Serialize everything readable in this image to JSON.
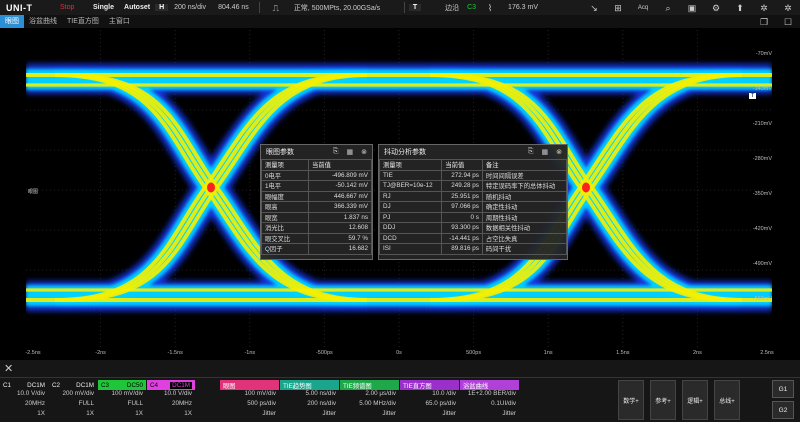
{
  "topbar": {
    "logo": "UNI-T",
    "run_state": "Stop",
    "single": "Single",
    "autoset": "Autoset",
    "h_key": "H",
    "timebase": "200 ns/div",
    "offset": "804.46 ns",
    "acq": "正常, 500MPts, 20.00GSa/s",
    "t_key": "T",
    "trig_type": "边沿",
    "trig_src": "C3",
    "trig_level": "176.3 mV",
    "acq_icon_label": "Acq"
  },
  "tabs": [
    "眼图",
    "浴盆曲线",
    "TIE直方图",
    "主窗口"
  ],
  "yticks": [
    "-70mV",
    "-140mV",
    "-210mV",
    "-280mV",
    "-350mV",
    "-420mV",
    "-490mV",
    "-560mV"
  ],
  "xticks": [
    "-2.5ns",
    "-2ns",
    "-1.5ns",
    "-1ns",
    "-500ps",
    "0s",
    "500ps",
    "1ns",
    "1.5ns",
    "2ns",
    "2.5ns"
  ],
  "side_label": "眼图",
  "eye_panel": {
    "title": "眼图参数",
    "headers": [
      "测量项",
      "当前值"
    ],
    "rows": [
      [
        "0电平",
        "-496.809 mV"
      ],
      [
        "1电平",
        "-50.142 mV"
      ],
      [
        "眼幅度",
        "446.667 mV"
      ],
      [
        "眼高",
        "366.339 mV"
      ],
      [
        "眼宽",
        "1.837 ns"
      ],
      [
        "消光比",
        "12.608"
      ],
      [
        "眼交叉比",
        "59.7 %"
      ],
      [
        "Q因子",
        "16.682"
      ]
    ]
  },
  "jitter_panel": {
    "title": "抖动分析参数",
    "headers": [
      "测量项",
      "当前值",
      "备注"
    ],
    "rows": [
      [
        "TIE",
        "272.94 ps",
        "时间间隔误差"
      ],
      [
        "TJ@BER=10e-12",
        "249.28 ps",
        "特定误码率下的总体抖动"
      ],
      [
        "RJ",
        "25.951 ps",
        "随机抖动"
      ],
      [
        "DJ",
        "97.066 ps",
        "确定性抖动"
      ],
      [
        "PJ",
        "0 s",
        "周期性抖动"
      ],
      [
        "DDJ",
        "93.300 ps",
        "数据相关性抖动"
      ],
      [
        "DCD",
        "-14.441 ps",
        "占空比失真"
      ],
      [
        "ISI",
        "89.816 ps",
        "码间干扰"
      ]
    ]
  },
  "channels": [
    {
      "name": "C1",
      "coupling": "DC1M",
      "scale": "10.0 V/div",
      "bw": "20MHz",
      "probe": "1X",
      "color": "#f2e600"
    },
    {
      "name": "C2",
      "coupling": "DC1M",
      "scale": "200 mV/div",
      "bw": "FULL",
      "probe": "1X",
      "color": "#00cfe0"
    },
    {
      "name": "C3",
      "coupling": "DC50",
      "scale": "100 mV/div",
      "bw": "FULL",
      "probe": "1X",
      "color": "#1fc63a"
    },
    {
      "name": "C4",
      "coupling": "DC1M",
      "scale": "10.0 V/div",
      "bw": "20MHz",
      "probe": "1X",
      "color": "#e040e0"
    }
  ],
  "funcs": [
    {
      "name": "眼图",
      "l1": "100 mV/div",
      "l2": "500 ps/div",
      "l3": "Jitter",
      "color": "#e0337a"
    },
    {
      "name": "TIE趋势图",
      "l1": "5.00 ns/div",
      "l2": "200 ns/div",
      "l3": "Jitter",
      "color": "#1aa58c"
    },
    {
      "name": "TIE频谱图",
      "l1": "2.00 μs/div",
      "l2": "5.00 MHz/div",
      "l3": "Jitter",
      "color": "#1fa84a"
    },
    {
      "name": "TIE直方图",
      "l1": "10.0  /div",
      "l2": "65.0 ps/div",
      "l3": "Jitter",
      "color": "#9a2fc9"
    },
    {
      "name": "浴盆曲线",
      "l1": "1E+2.00 BER/div",
      "l2": "0.1UI/div",
      "l3": "Jitter",
      "color": "#b040d8"
    }
  ],
  "menu_buttons": [
    "数学+",
    "参考+",
    "逻辑+",
    "总线+"
  ],
  "g_buttons": [
    "G1",
    "G2"
  ],
  "trig_marker": "T"
}
